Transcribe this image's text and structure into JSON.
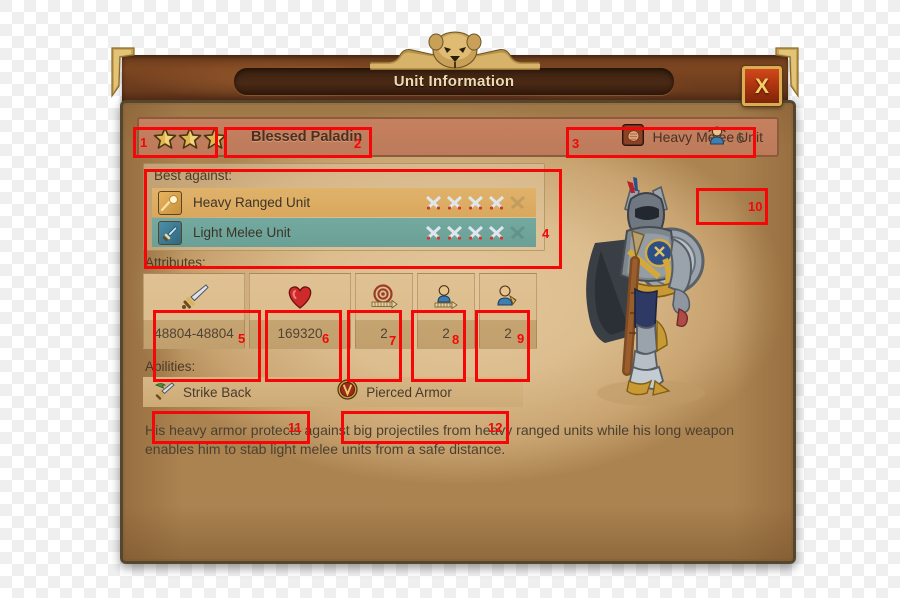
{
  "window": {
    "title": "Unit Information",
    "close_label": "X",
    "close_icon": "close-x-icon",
    "crest_icon": "lion-head-crest-icon"
  },
  "unit": {
    "stars": 3,
    "star_icon": "star-icon",
    "name": "Blessed Paladin",
    "type_label": "Heavy Melee Unit",
    "type_icon": "fist-heavy-melee-icon",
    "portrait_icon": "paladin-knight-portrait"
  },
  "capacity": {
    "icon": "unit-capacity-icon",
    "value": "6"
  },
  "best_against": {
    "title": "Best against:",
    "rating_icon": "crossed-swords-icon",
    "rows": [
      {
        "label": "Heavy Ranged Unit",
        "icon": "cannonball-heavy-ranged-icon",
        "rating": 4,
        "rating_max": 5,
        "theme": "ranged"
      },
      {
        "label": "Light Melee Unit",
        "icon": "sword-light-melee-icon",
        "rating": 4,
        "rating_max": 5,
        "theme": "melee"
      }
    ]
  },
  "attributes": {
    "title": "Attributes:",
    "cells": [
      {
        "icon": "sword-attack-icon",
        "value": "48804-48804",
        "wide": true
      },
      {
        "icon": "heart-health-icon",
        "value": "169320",
        "wide": true
      },
      {
        "icon": "target-range-icon",
        "value": "2",
        "wide": false
      },
      {
        "icon": "unit-speed-icon",
        "value": "2",
        "wide": false
      },
      {
        "icon": "unit-vision-icon",
        "value": "2",
        "wide": false
      }
    ]
  },
  "abilities": {
    "title": "Abilities:",
    "items": [
      {
        "label": "Strike Back",
        "icon": "sword-strike-back-icon"
      },
      {
        "label": "Pierced Armor",
        "icon": "shield-pierced-armor-icon"
      }
    ]
  },
  "description": "His heavy armor protects against big projectiles from heavy ranged units while his long weapon enables him to stab light melee units from a safe distance.",
  "annotations": {
    "color": "#f60606",
    "markers": [
      {
        "id": "1",
        "label": "1",
        "target": "star-rating"
      },
      {
        "id": "2",
        "label": "2",
        "target": "unit-name"
      },
      {
        "id": "3",
        "label": "3",
        "target": "unit-type"
      },
      {
        "id": "4",
        "label": "4",
        "target": "best-against-box"
      },
      {
        "id": "5",
        "label": "5",
        "target": "attribute-attack"
      },
      {
        "id": "6",
        "label": "6",
        "target": "attribute-health"
      },
      {
        "id": "7",
        "label": "7",
        "target": "attribute-range"
      },
      {
        "id": "8",
        "label": "8",
        "target": "attribute-speed"
      },
      {
        "id": "9",
        "label": "9",
        "target": "attribute-vision"
      },
      {
        "id": "10",
        "label": "10",
        "target": "capacity-badge"
      },
      {
        "id": "11",
        "label": "11",
        "target": "ability-strike-back"
      },
      {
        "id": "12",
        "label": "12",
        "target": "ability-pierced-armor"
      }
    ]
  }
}
